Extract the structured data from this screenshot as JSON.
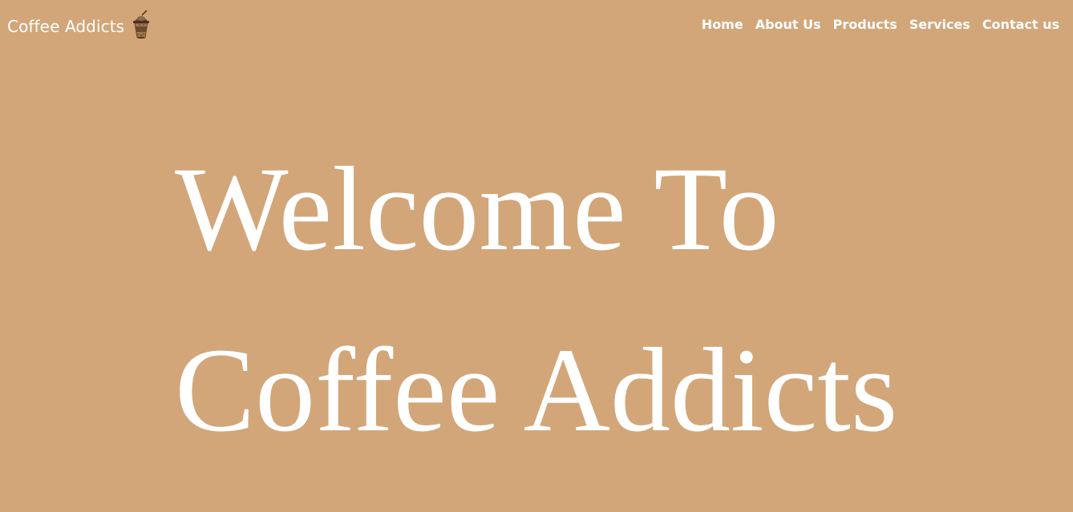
{
  "page": {
    "background_color": "#D2A679",
    "text_color": "#FFFFFF"
  },
  "navbar": {
    "brand": {
      "title": "Coffee Addicts",
      "icon": "coffee-cup-icon"
    },
    "links": [
      {
        "label": "Home"
      },
      {
        "label": "About Us"
      },
      {
        "label": "Products"
      },
      {
        "label": "Services"
      },
      {
        "label": "Contact us"
      }
    ]
  },
  "hero": {
    "line1": "Welcome To",
    "line2": "Coffee Addicts"
  }
}
